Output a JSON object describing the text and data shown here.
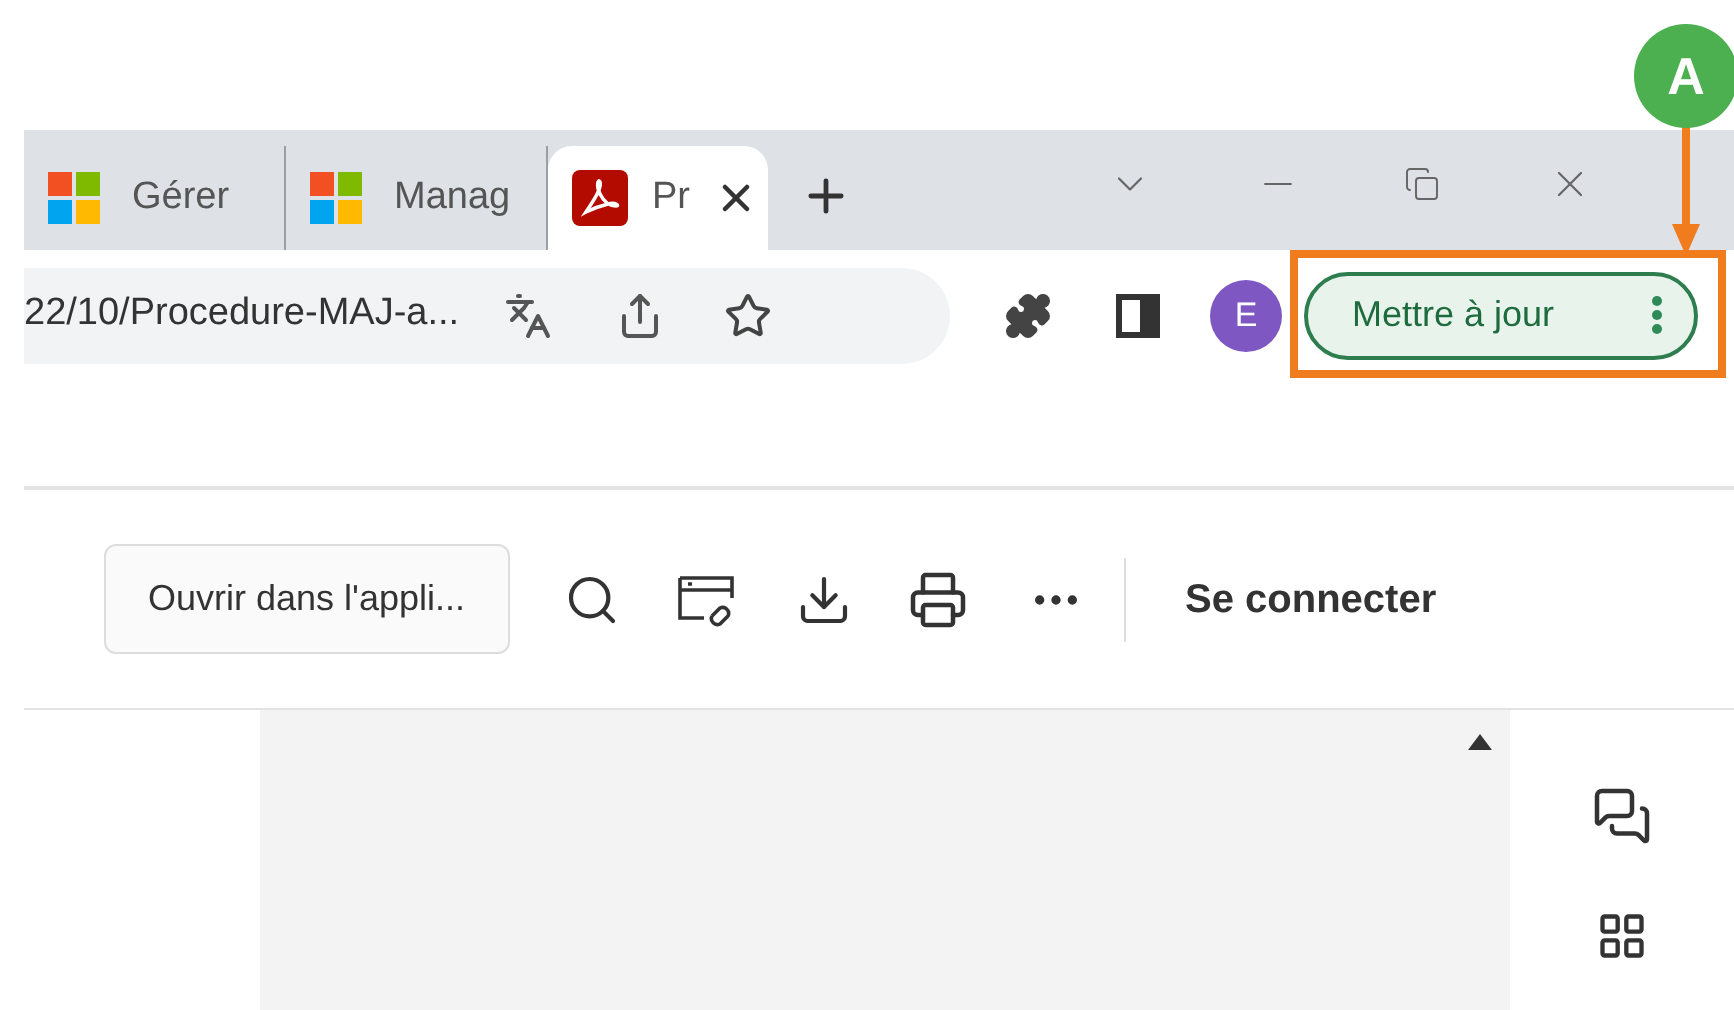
{
  "browser": {
    "tabs": [
      {
        "title": "Gérer",
        "selected": false,
        "kind": "windows"
      },
      {
        "title": "Manag",
        "selected": false,
        "kind": "windows"
      },
      {
        "title": "Pr",
        "selected": true,
        "kind": "pdf"
      }
    ],
    "address": "22/10/Procedure-MAJ-a...",
    "profile_initial": "E",
    "update_button": "Mettre à jour"
  },
  "viewer": {
    "open_in_app": "Ouvrir dans l'appli...",
    "sign_in": "Se connecter"
  },
  "callout": {
    "label": "A"
  }
}
